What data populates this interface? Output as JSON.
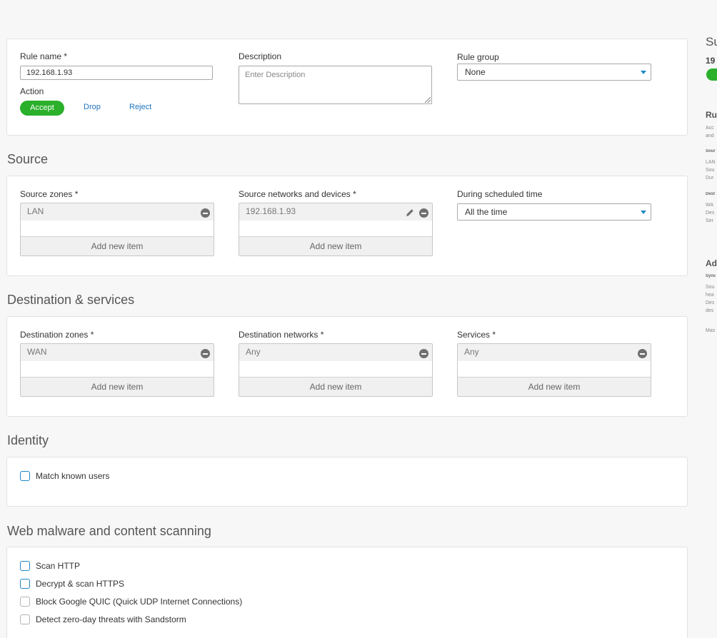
{
  "rule": {
    "name_label": "Rule name *",
    "name_value": "192.168.1.93",
    "description_label": "Description",
    "description_placeholder": "Enter Description",
    "group_label": "Rule group",
    "group_value": "None",
    "action_label": "Action",
    "actions": [
      "Accept",
      "Drop",
      "Reject"
    ]
  },
  "source": {
    "title": "Source",
    "zones_label": "Source zones *",
    "zones_value": "LAN",
    "networks_label": "Source networks and devices *",
    "networks_value": "192.168.1.93",
    "schedule_label": "During scheduled time",
    "schedule_value": "All the time",
    "add_item": "Add new item"
  },
  "destination": {
    "title": "Destination & services",
    "zones_label": "Destination zones *",
    "zones_value": "WAN",
    "networks_label": "Destination networks *",
    "networks_value": "Any",
    "services_label": "Services *",
    "services_value": "Any",
    "add_item": "Add new item"
  },
  "identity": {
    "title": "Identity",
    "match_known_users": "Match known users"
  },
  "web": {
    "title": "Web malware and content scanning",
    "options": [
      "Scan HTTP",
      "Decrypt & scan HTTPS",
      "Block Google QUIC (Quick UDP Internet Connections)",
      "Detect zero-day threats with Sandstorm"
    ]
  },
  "summary": {
    "title": "Su",
    "rule_name": "19",
    "rule_heading": "Ru",
    "rule_line1": "Acc",
    "rule_line2": "and",
    "src_heading": "Sour",
    "src_line1": "LAN",
    "src_line2": "Sou",
    "src_line3": "Dur",
    "dst_heading": "Dest",
    "dst_line1": "WA",
    "dst_line2": "Des",
    "dst_line3": "Ser",
    "adv_heading": "Ad",
    "adv_sub": "Sync",
    "adv_line1": "Sou",
    "adv_line2": "hea",
    "adv_line3": "Des",
    "adv_line4": "des",
    "adv_line5": "Mas"
  }
}
